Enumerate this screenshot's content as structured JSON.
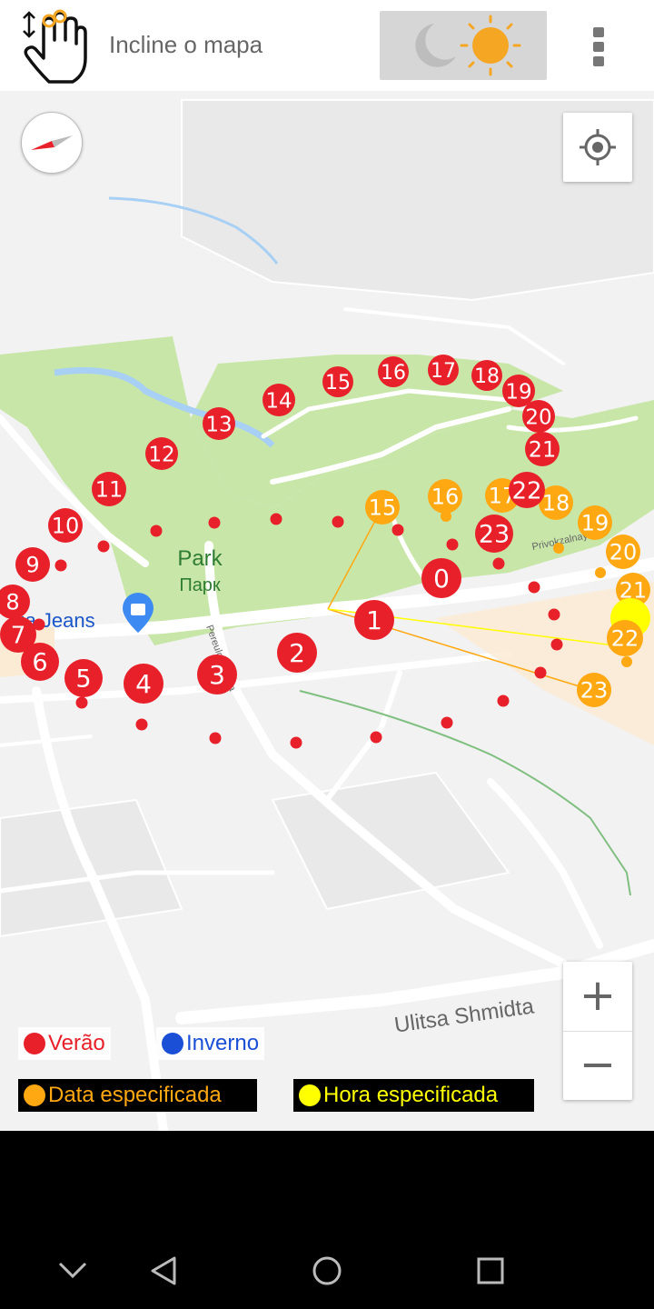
{
  "toolbar": {
    "title": "Incline o mapa",
    "tilt_icon": "tilt-hand-icon",
    "theme_icons": [
      "moon-icon",
      "sun-icon"
    ],
    "menu_icon": "more-vert-icon"
  },
  "map": {
    "park_label": "Park",
    "park_label_ru": "Парк",
    "shop_label": "ria Jeans",
    "street_small": "Pereulok ... ova",
    "street_top": "Privokzalnaya",
    "street_main": "Ulitsa Shmidta",
    "zoom_in": "+",
    "zoom_out": "−",
    "summer_hours": [
      "0",
      "1",
      "2",
      "3",
      "4",
      "5",
      "6",
      "7",
      "8",
      "9",
      "10",
      "11",
      "12",
      "13",
      "14",
      "15",
      "16",
      "17",
      "18",
      "19",
      "20",
      "21",
      "22",
      "23"
    ],
    "date_hours": [
      "15",
      "16",
      "17",
      "18",
      "19",
      "20",
      "21",
      "22",
      "23"
    ]
  },
  "legend": {
    "summer": "Verão",
    "winter": "Inverno",
    "date": "Data especificada",
    "hour": "Hora especificada"
  },
  "colors": {
    "summer": "#e8202a",
    "winter": "#1a4fd6",
    "date": "#ffa812",
    "hour": "#ffff00",
    "park": "#c8e6a8",
    "water": "#a8d0f5"
  },
  "nav": {
    "icons": [
      "chevron-down-icon",
      "back-icon",
      "home-icon",
      "recents-icon"
    ]
  }
}
